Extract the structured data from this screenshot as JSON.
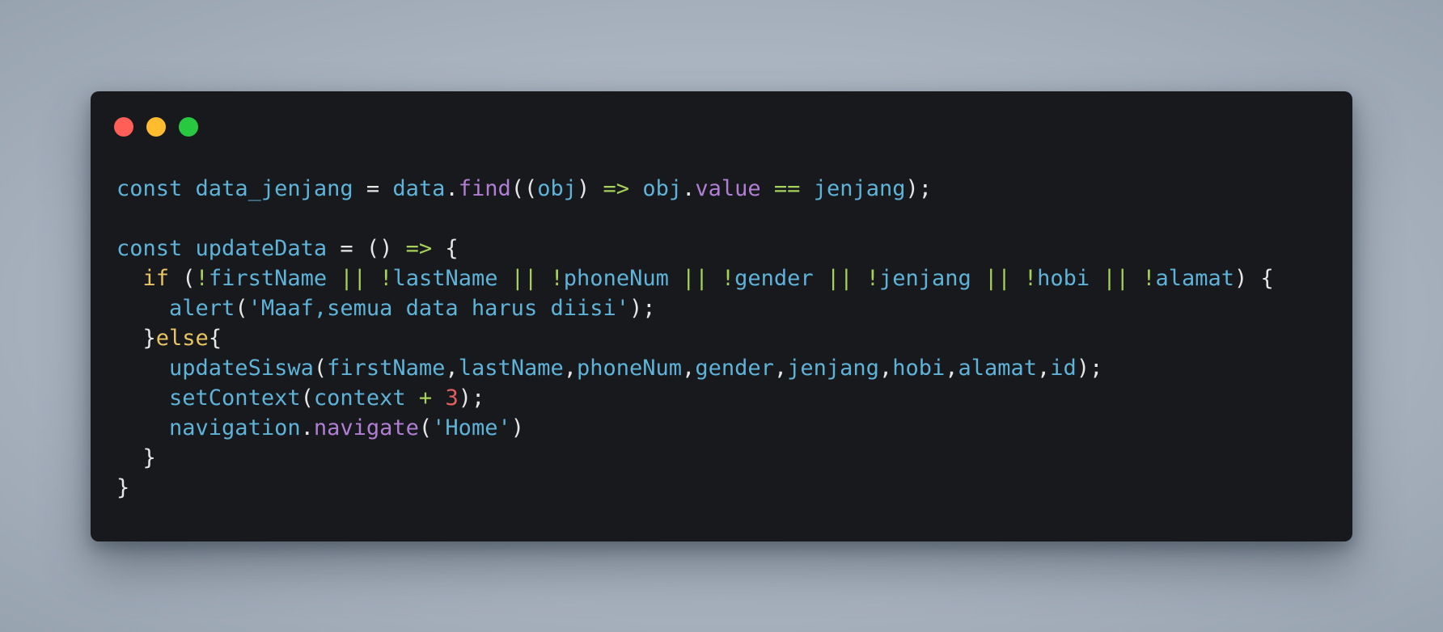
{
  "window": {
    "controls": [
      {
        "name": "close-dot",
        "color": "#ff5f57"
      },
      {
        "name": "minimize-dot",
        "color": "#febc2e"
      },
      {
        "name": "maximize-dot",
        "color": "#28c840"
      }
    ]
  },
  "colors": {
    "plain": "#e6e6e6",
    "keyword": "#5fb3d9",
    "identifier": "#5fb3d9",
    "method": "#b07fd4",
    "operator": "#a6d15a",
    "control": "#e8c462",
    "string": "#5fb3d9",
    "number": "#e06060"
  },
  "code": {
    "language": "javascript",
    "lines": [
      [
        {
          "t": "const",
          "c": "keyword"
        },
        {
          "t": " "
        },
        {
          "t": "data_jenjang",
          "c": "identifier"
        },
        {
          "t": " = "
        },
        {
          "t": "data",
          "c": "identifier"
        },
        {
          "t": "."
        },
        {
          "t": "find",
          "c": "method"
        },
        {
          "t": "(("
        },
        {
          "t": "obj",
          "c": "identifier"
        },
        {
          "t": ") "
        },
        {
          "t": "=>",
          "c": "operator"
        },
        {
          "t": " "
        },
        {
          "t": "obj",
          "c": "identifier"
        },
        {
          "t": "."
        },
        {
          "t": "value",
          "c": "method"
        },
        {
          "t": " "
        },
        {
          "t": "==",
          "c": "operator"
        },
        {
          "t": " "
        },
        {
          "t": "jenjang",
          "c": "identifier"
        },
        {
          "t": ");"
        }
      ],
      [],
      [
        {
          "t": "const",
          "c": "keyword"
        },
        {
          "t": " "
        },
        {
          "t": "updateData",
          "c": "identifier"
        },
        {
          "t": " = () "
        },
        {
          "t": "=>",
          "c": "operator"
        },
        {
          "t": " {"
        }
      ],
      [
        {
          "t": "  "
        },
        {
          "t": "if",
          "c": "control"
        },
        {
          "t": " ("
        },
        {
          "t": "!",
          "c": "operator"
        },
        {
          "t": "firstName",
          "c": "identifier"
        },
        {
          "t": " "
        },
        {
          "t": "||",
          "c": "operator"
        },
        {
          "t": " "
        },
        {
          "t": "!",
          "c": "operator"
        },
        {
          "t": "lastName",
          "c": "identifier"
        },
        {
          "t": " "
        },
        {
          "t": "||",
          "c": "operator"
        },
        {
          "t": " "
        },
        {
          "t": "!",
          "c": "operator"
        },
        {
          "t": "phoneNum",
          "c": "identifier"
        },
        {
          "t": " "
        },
        {
          "t": "||",
          "c": "operator"
        },
        {
          "t": " "
        },
        {
          "t": "!",
          "c": "operator"
        },
        {
          "t": "gender",
          "c": "identifier"
        },
        {
          "t": " "
        },
        {
          "t": "||",
          "c": "operator"
        },
        {
          "t": " "
        },
        {
          "t": "!",
          "c": "operator"
        },
        {
          "t": "jenjang",
          "c": "identifier"
        },
        {
          "t": " "
        },
        {
          "t": "||",
          "c": "operator"
        },
        {
          "t": " "
        },
        {
          "t": "!",
          "c": "operator"
        },
        {
          "t": "hobi",
          "c": "identifier"
        },
        {
          "t": " "
        },
        {
          "t": "||",
          "c": "operator"
        },
        {
          "t": " "
        },
        {
          "t": "!",
          "c": "operator"
        },
        {
          "t": "alamat",
          "c": "identifier"
        },
        {
          "t": ") {"
        }
      ],
      [
        {
          "t": "    "
        },
        {
          "t": "alert",
          "c": "identifier"
        },
        {
          "t": "("
        },
        {
          "t": "'Maaf,semua data harus diisi'",
          "c": "string"
        },
        {
          "t": ");"
        }
      ],
      [
        {
          "t": "  }"
        },
        {
          "t": "else",
          "c": "control"
        },
        {
          "t": "{"
        }
      ],
      [
        {
          "t": "    "
        },
        {
          "t": "updateSiswa",
          "c": "identifier"
        },
        {
          "t": "("
        },
        {
          "t": "firstName",
          "c": "identifier"
        },
        {
          "t": ","
        },
        {
          "t": "lastName",
          "c": "identifier"
        },
        {
          "t": ","
        },
        {
          "t": "phoneNum",
          "c": "identifier"
        },
        {
          "t": ","
        },
        {
          "t": "gender",
          "c": "identifier"
        },
        {
          "t": ","
        },
        {
          "t": "jenjang",
          "c": "identifier"
        },
        {
          "t": ","
        },
        {
          "t": "hobi",
          "c": "identifier"
        },
        {
          "t": ","
        },
        {
          "t": "alamat",
          "c": "identifier"
        },
        {
          "t": ","
        },
        {
          "t": "id",
          "c": "identifier"
        },
        {
          "t": ");"
        }
      ],
      [
        {
          "t": "    "
        },
        {
          "t": "setContext",
          "c": "identifier"
        },
        {
          "t": "("
        },
        {
          "t": "context",
          "c": "identifier"
        },
        {
          "t": " "
        },
        {
          "t": "+",
          "c": "operator"
        },
        {
          "t": " "
        },
        {
          "t": "3",
          "c": "number"
        },
        {
          "t": ");"
        }
      ],
      [
        {
          "t": "    "
        },
        {
          "t": "navigation",
          "c": "identifier"
        },
        {
          "t": "."
        },
        {
          "t": "navigate",
          "c": "method"
        },
        {
          "t": "("
        },
        {
          "t": "'Home'",
          "c": "string"
        },
        {
          "t": ")"
        }
      ],
      [
        {
          "t": "  }"
        }
      ],
      [
        {
          "t": "}"
        }
      ]
    ]
  }
}
